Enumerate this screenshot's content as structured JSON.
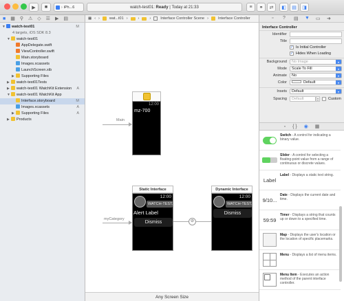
{
  "toolbar": {
    "scheme": "iPh...6",
    "target": "watch-test01",
    "status_project": "watch-test01:",
    "status_state": "Ready",
    "status_time": "Today at 21:33"
  },
  "navigator": {
    "rows": [
      {
        "label": "watch-test01",
        "indent": 0,
        "type": "project",
        "badge": "M",
        "bold": true
      },
      {
        "label": "4 targets, iOS SDK 8.3",
        "indent": 0,
        "type": "sub",
        "badge": ""
      },
      {
        "label": "watch-test01",
        "indent": 1,
        "type": "folder",
        "badge": ""
      },
      {
        "label": "AppDelegate.swift",
        "indent": 2,
        "type": "swift",
        "badge": ""
      },
      {
        "label": "ViewController.swift",
        "indent": 2,
        "type": "swift",
        "badge": ""
      },
      {
        "label": "Main.storyboard",
        "indent": 2,
        "type": "storyboard",
        "badge": ""
      },
      {
        "label": "Images.xcassets",
        "indent": 2,
        "type": "assets",
        "badge": ""
      },
      {
        "label": "LaunchScreen.xib",
        "indent": 2,
        "type": "xib",
        "badge": ""
      },
      {
        "label": "Supporting Files",
        "indent": 2,
        "type": "folder",
        "badge": ""
      },
      {
        "label": "watch-test01Tests",
        "indent": 1,
        "type": "folder",
        "badge": ""
      },
      {
        "label": "watch-test01 WatchKit Extension",
        "indent": 1,
        "type": "folder",
        "badge": "A"
      },
      {
        "label": "watch-test01 WatchKit App",
        "indent": 1,
        "type": "folder",
        "badge": ""
      },
      {
        "label": "Interface.storyboard",
        "indent": 2,
        "type": "storyboard",
        "badge": "M",
        "selected": true
      },
      {
        "label": "Images.xcassets",
        "indent": 2,
        "type": "assets",
        "badge": "A"
      },
      {
        "label": "Supporting Files",
        "indent": 2,
        "type": "folder",
        "badge": "A"
      },
      {
        "label": "Products",
        "indent": 1,
        "type": "folder",
        "badge": ""
      }
    ]
  },
  "jumpbar": {
    "items": [
      "wat...t01",
      "Interface Controller Scene",
      "Interface Controller"
    ]
  },
  "canvas": {
    "main_arrow_label": "Main",
    "main_time": "12:00",
    "main_label": "mz-700",
    "static_title": "Static Interface",
    "static_time": "12:00",
    "static_app": "WATCH-TEST...",
    "static_alert": "Alert Label",
    "static_button": "Dismiss",
    "category_label": "myCategory",
    "dynamic_title": "Dynamic Interface",
    "dynamic_time": "12:00",
    "dynamic_app": "WATCH-TEST...",
    "dynamic_button": "Dismiss",
    "bottom": "Any Screen Size"
  },
  "inspector": {
    "section": "Interface Controller",
    "identifier_label": "Identifier",
    "title_label": "Title",
    "is_initial": "Is Initial Controller",
    "hides_loading": "Hides When Loading",
    "background_label": "Background",
    "background_value": "No Image",
    "mode_label": "Mode",
    "mode_value": "Scale To Fill",
    "animate_label": "Animate",
    "animate_value": "No",
    "color_label": "Color",
    "color_value": "Default",
    "insets_label": "Insets",
    "insets_value": "Default",
    "spacing_label": "Spacing",
    "spacing_value": "Default",
    "custom_label": "Custom"
  },
  "library": {
    "items": [
      {
        "name": "Switch",
        "desc": " - A control for indicating a binary value.",
        "thumb": "switch"
      },
      {
        "name": "Slider",
        "desc": " - A control for selecting a floating-point value from a range of continuous or discrete values.",
        "thumb": "slider"
      },
      {
        "name": "Label",
        "desc": " - Displays a static text string.",
        "thumb": "Label"
      },
      {
        "name": "Date",
        "desc": " - Displays the current date and time.",
        "thumb": "9/10..."
      },
      {
        "name": "Timer",
        "desc": " - Displays a string that counts up or down to a specified time.",
        "thumb": "59:59"
      },
      {
        "name": "Map",
        "desc": " - Displays the user's location or the location of specific placemarks.",
        "thumb": "map"
      },
      {
        "name": "Menu",
        "desc": " - Displays a list of menu items.",
        "thumb": "menu"
      },
      {
        "name": "Menu Item",
        "desc": " - Executes an action method of the parent interface controller.",
        "thumb": "menuitem"
      }
    ]
  },
  "colors": {
    "selection": "#c8d7ec",
    "accent": "#4a8af0",
    "switch_on": "#5fd35f"
  }
}
